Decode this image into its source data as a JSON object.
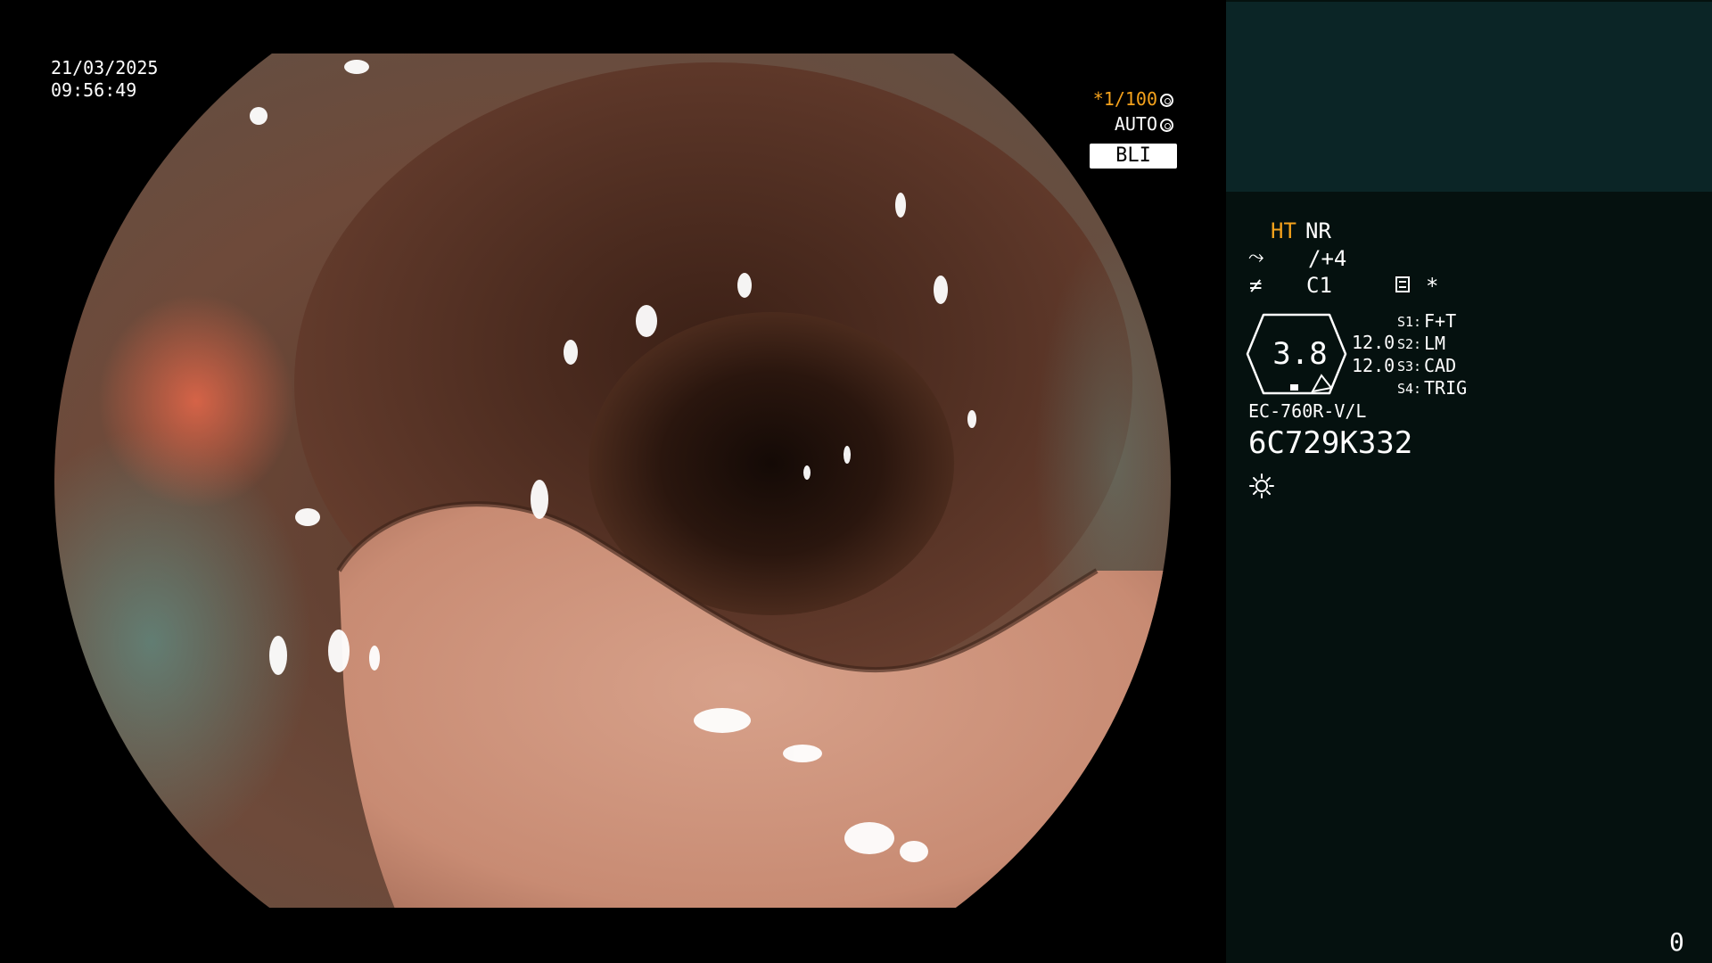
{
  "image_panel": {
    "date": "21/03/2025",
    "time": "09:56:49",
    "shutter": "*1/100",
    "iris": "AUTO",
    "light_mode": "BLI",
    "shutter_icon": "aperture-icon",
    "iris_icon": "iris-icon"
  },
  "info_panel": {
    "ht_label": "HT",
    "nr_label": "NR",
    "enhancement_icon": "structure-enhancement-icon",
    "enhancement_value": "/+4",
    "color_icon": "color-enhancement-icon",
    "color_value": "C1",
    "menu_icon": "menu-icon",
    "star": "*",
    "zoom_value": "3.8",
    "aux_values": [
      "12.0",
      "12.0"
    ],
    "switches": [
      {
        "label": "S1:",
        "value": "F+T"
      },
      {
        "label": "S2:",
        "value": "LM"
      },
      {
        "label": "S3:",
        "value": "CAD"
      },
      {
        "label": "S4:",
        "value": "TRIG"
      }
    ],
    "scope_model": "EC-760R-V/L",
    "scope_serial": "6C729K332",
    "light_icon": "light-source-icon",
    "counter": "0"
  },
  "colors": {
    "accent_orange": "#f5a21c",
    "panel_bg": "#05110f",
    "panel_header_bg": "#0b2526",
    "text": "#ffffff"
  }
}
